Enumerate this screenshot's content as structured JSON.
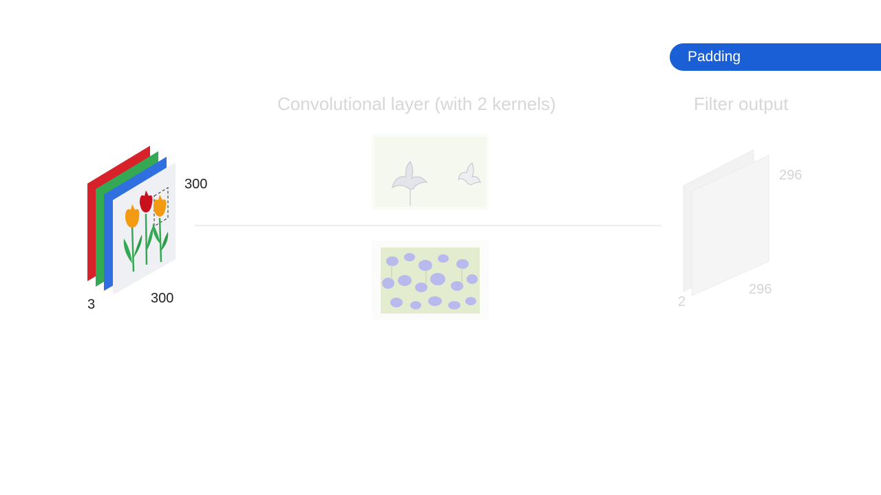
{
  "badge": {
    "label": "Padding"
  },
  "headings": {
    "conv_layer": "Convolutional layer (with 2 kernels)",
    "filter_output": "Filter output"
  },
  "input_volume": {
    "height": "300",
    "width": "300",
    "depth": "3",
    "channel_colors": [
      "#d8222b",
      "#34a853",
      "#2f6fe0"
    ]
  },
  "output_volume": {
    "height": "296",
    "width": "296",
    "depth": "2"
  },
  "kernels": [
    {
      "name": "iris-line-kernel"
    },
    {
      "name": "iris-field-kernel"
    }
  ],
  "colors": {
    "accent": "#1a5fd6",
    "faded_text": "#d7d7d7"
  }
}
